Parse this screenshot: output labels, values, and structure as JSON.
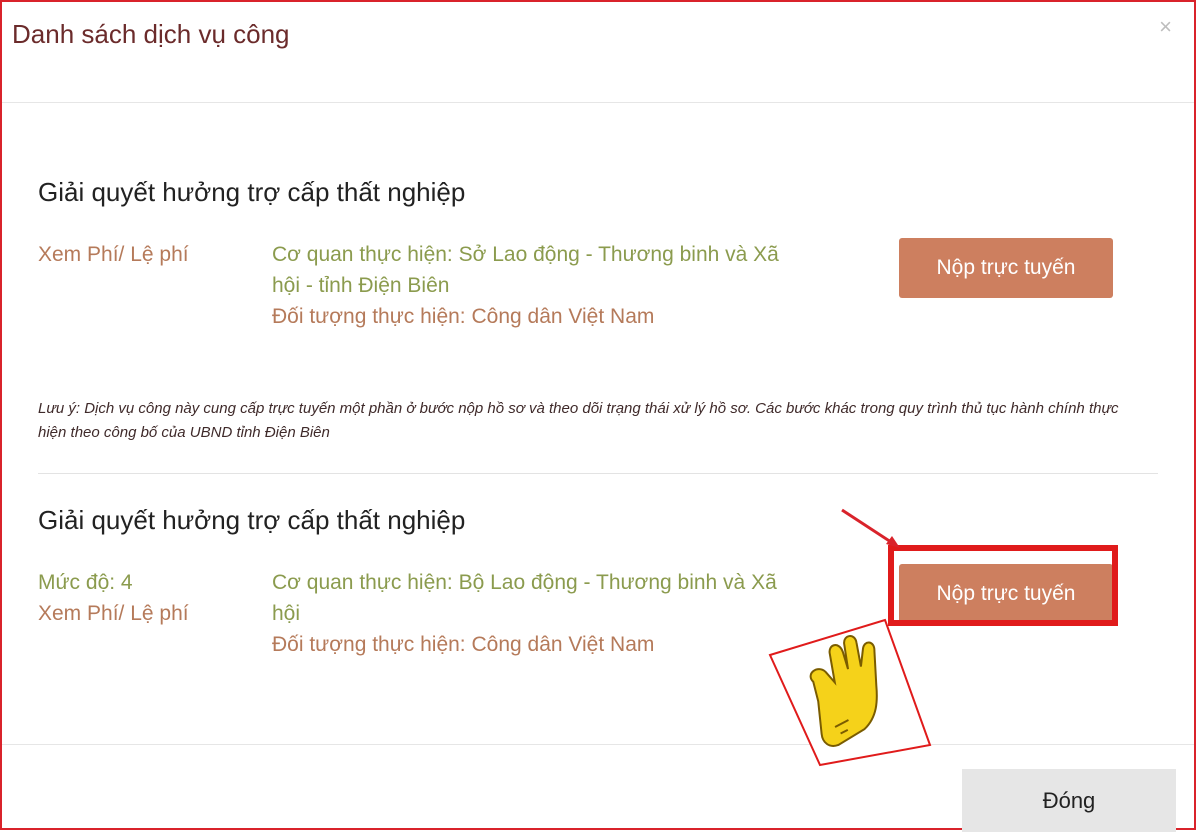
{
  "dialog": {
    "title": "Danh sách dịch vụ công",
    "close_symbol": "×"
  },
  "services": [
    {
      "title": "Giải quyết hưởng trợ cấp thất nghiệp",
      "fee_link": "Xem Phí/ Lệ phí",
      "agency_line1": "Cơ quan thực hiện: Sở Lao động - Thương binh và Xã",
      "agency_line2": "hội - tỉnh Điện Biên",
      "subject": "Đối tượng thực hiện: Công dân Việt Nam",
      "submit_label": "Nộp trực tuyến"
    },
    {
      "title": "Giải quyết hưởng trợ cấp thất nghiệp",
      "level": "Mức độ: 4",
      "fee_link": "Xem Phí/ Lệ phí",
      "agency_line1": "Cơ quan thực hiện: Bộ Lao động - Thương binh và Xã",
      "agency_line2": "hội",
      "subject": "Đối tượng thực hiện: Công dân Việt Nam",
      "submit_label": "Nộp trực tuyến"
    }
  ],
  "note": "Lưu ý: Dịch vụ công này cung cấp trực tuyến một phần ở bước nộp hồ sơ và theo dõi trạng thái xử lý hồ sơ. Các bước khác trong quy trình thủ tục hành chính thực hiện theo công bố của UBND tỉnh Điện Biên",
  "footer": {
    "close_label": "Đóng"
  },
  "annotation": {
    "highlight_color": "#e01b1b",
    "hand_color": "#f5d21a",
    "pointer": "hand-pointer-icon"
  },
  "colors": {
    "submit_button": "#cd7f5f",
    "modal_border": "#d9232b",
    "agency_text": "#8b9b4e",
    "link_text": "#b57a5a"
  }
}
